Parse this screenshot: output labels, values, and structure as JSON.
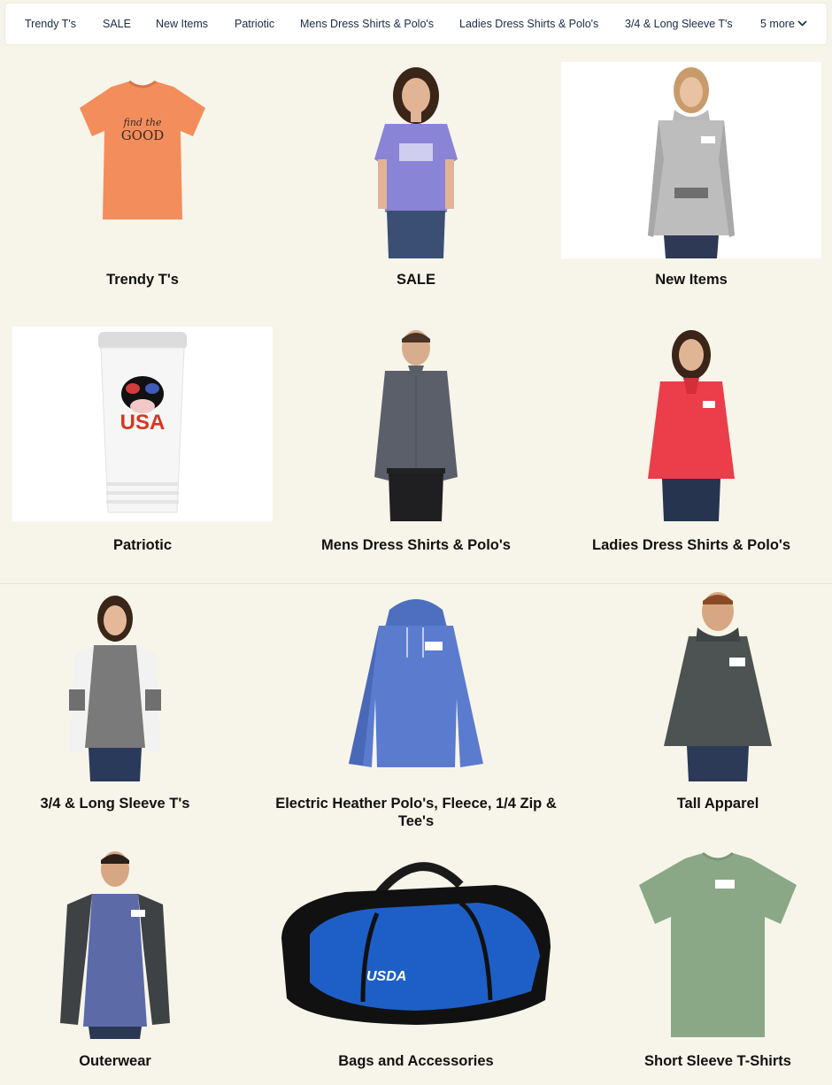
{
  "nav": {
    "items": [
      {
        "label": "Trendy T's"
      },
      {
        "label": "SALE"
      },
      {
        "label": "New Items"
      },
      {
        "label": "Patriotic"
      },
      {
        "label": "Mens Dress Shirts & Polo's"
      },
      {
        "label": "Ladies Dress Shirts & Polo's"
      },
      {
        "label": "3/4 & Long Sleeve T's"
      }
    ],
    "more_label": "5 more",
    "more_icon": "chevron-down-icon"
  },
  "grid_top": [
    {
      "label": "Trendy T's",
      "image": "orange-tshirt-find-the-good",
      "print_line1": "find the",
      "print_line2": "GOOD"
    },
    {
      "label": "SALE",
      "image": "woman-purple-tshirt"
    },
    {
      "label": "New Items",
      "image": "woman-heather-grey-funnel-neck"
    },
    {
      "label": "Patriotic",
      "image": "white-tumbler-usa-cow",
      "print": "USA"
    },
    {
      "label": "Mens Dress Shirts & Polo's",
      "image": "man-grey-dress-shirt"
    },
    {
      "label": "Ladies Dress Shirts & Polo's",
      "image": "woman-red-polo"
    }
  ],
  "grid_bottom": [
    {
      "label": "3/4 & Long Sleeve T's",
      "image": "woman-raglan-long-sleeve"
    },
    {
      "label": "Electric Heather Polo's, Fleece, 1/4 Zip & Tee's",
      "image": "blue-heather-hoodie"
    },
    {
      "label": "Tall Apparel",
      "image": "man-grey-hoodie"
    },
    {
      "label": "Outerwear",
      "image": "man-raglan-hoodie"
    },
    {
      "label": "Bags and Accessories",
      "image": "blue-black-duffel-bag",
      "print": "USDA"
    },
    {
      "label": "Short Sleeve T-Shirts",
      "image": "green-heather-tshirt"
    }
  ],
  "colors": {
    "page_bg": "#f7f5e9",
    "nav_bg": "#ffffff",
    "nav_text": "#1b2a44",
    "label_text": "#111111"
  }
}
